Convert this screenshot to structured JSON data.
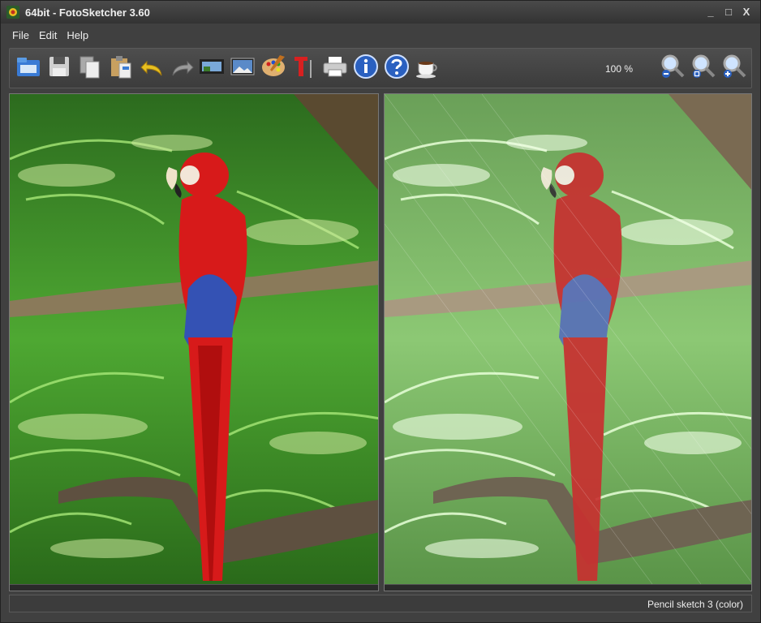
{
  "window": {
    "title": "64bit - FotoSketcher 3.60",
    "controls": {
      "minimize": "_",
      "maximize": "□",
      "close": "X"
    }
  },
  "menu": {
    "items": [
      {
        "label": "File"
      },
      {
        "label": "Edit"
      },
      {
        "label": "Help"
      }
    ]
  },
  "toolbar": {
    "buttons": [
      {
        "name": "open-icon"
      },
      {
        "name": "save-icon"
      },
      {
        "name": "copy-icon"
      },
      {
        "name": "paste-icon"
      },
      {
        "name": "undo-icon"
      },
      {
        "name": "redo-icon"
      },
      {
        "name": "filmstrip-icon"
      },
      {
        "name": "picture-icon"
      },
      {
        "name": "palette-icon"
      },
      {
        "name": "text-icon"
      },
      {
        "name": "print-icon"
      },
      {
        "name": "info-icon"
      },
      {
        "name": "help-icon"
      },
      {
        "name": "coffee-icon"
      },
      {
        "name": "zoom-out-icon"
      },
      {
        "name": "zoom-fit-icon"
      },
      {
        "name": "zoom-in-icon"
      }
    ],
    "zoom_level": "100 %"
  },
  "status": {
    "effect": "Pencil sketch 3 (color)"
  },
  "colors": {
    "background": "#404040",
    "foliage": "#3f8f2a",
    "parrot_red": "#d71a1a",
    "parrot_blue": "#3452b4"
  }
}
